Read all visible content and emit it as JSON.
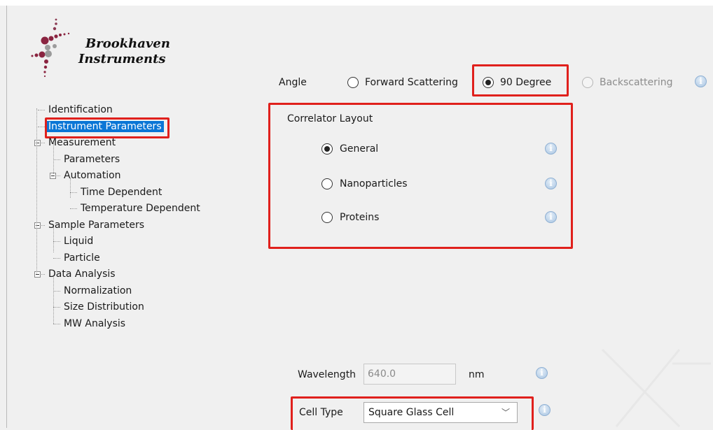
{
  "logo": {
    "line1": "Brookhaven",
    "line2": "Instruments"
  },
  "tree": [
    {
      "label": "Identification",
      "level": 1,
      "expander": false
    },
    {
      "label": "Instrument Parameters",
      "level": 1,
      "expander": false,
      "selected": true
    },
    {
      "label": "Measurement",
      "level": 1,
      "expander": true
    },
    {
      "label": "Parameters",
      "level": 2,
      "expander": false
    },
    {
      "label": "Automation",
      "level": 2,
      "expander": true
    },
    {
      "label": "Time Dependent",
      "level": 3,
      "expander": false
    },
    {
      "label": "Temperature Dependent",
      "level": 3,
      "expander": false
    },
    {
      "label": "Sample Parameters",
      "level": 1,
      "expander": true
    },
    {
      "label": "Liquid",
      "level": 2,
      "expander": false
    },
    {
      "label": "Particle",
      "level": 2,
      "expander": false
    },
    {
      "label": "Data Analysis",
      "level": 1,
      "expander": true
    },
    {
      "label": "Normalization",
      "level": 2,
      "expander": false
    },
    {
      "label": "Size Distribution",
      "level": 2,
      "expander": false
    },
    {
      "label": "MW Analysis",
      "level": 2,
      "expander": false
    }
  ],
  "angle": {
    "label": "Angle",
    "options": [
      {
        "label": "Forward Scattering",
        "checked": false,
        "disabled": false
      },
      {
        "label": "90 Degree",
        "checked": true,
        "disabled": false
      },
      {
        "label": "Backscattering",
        "checked": false,
        "disabled": true
      }
    ]
  },
  "correlator": {
    "title": "Correlator Layout",
    "options": [
      {
        "label": "General",
        "checked": true
      },
      {
        "label": "Nanoparticles",
        "checked": false
      },
      {
        "label": "Proteins",
        "checked": false
      }
    ]
  },
  "wavelength": {
    "label": "Wavelength",
    "value": "640.0",
    "unit": "nm"
  },
  "cell_type": {
    "label": "Cell Type",
    "value": "Square Glass Cell"
  },
  "icons": {
    "info": "info-icon",
    "expander": "collapse-minus-icon",
    "dropdown": "chevron-down-icon"
  },
  "info_glyph": "i",
  "dropdown_glyph": "﹀",
  "colors": {
    "selection": "#0a76d6",
    "highlight": "#e0201c"
  }
}
